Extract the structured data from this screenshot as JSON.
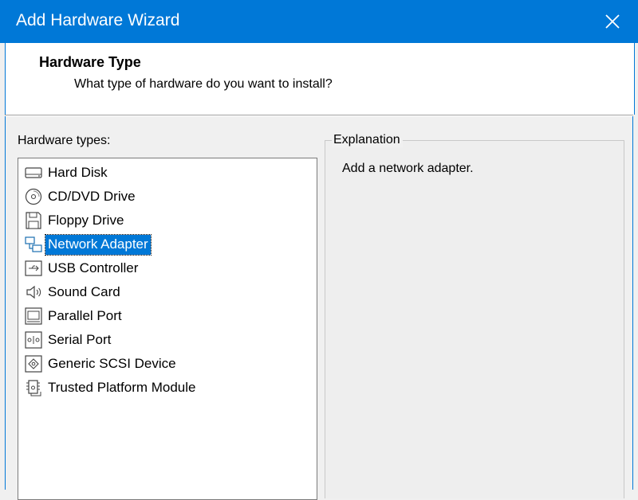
{
  "window": {
    "title": "Add Hardware Wizard"
  },
  "header": {
    "title": "Hardware Type",
    "subtitle": "What type of hardware do you want to install?"
  },
  "list": {
    "label": "Hardware types:",
    "items": [
      {
        "label": "Hard Disk",
        "icon": "hard-disk-icon"
      },
      {
        "label": "CD/DVD Drive",
        "icon": "cd-dvd-icon"
      },
      {
        "label": "Floppy Drive",
        "icon": "floppy-icon"
      },
      {
        "label": "Network Adapter",
        "icon": "network-adapter-icon",
        "selected": true
      },
      {
        "label": "USB Controller",
        "icon": "usb-icon"
      },
      {
        "label": "Sound Card",
        "icon": "speaker-icon"
      },
      {
        "label": "Parallel Port",
        "icon": "parallel-port-icon"
      },
      {
        "label": "Serial Port",
        "icon": "serial-port-icon"
      },
      {
        "label": "Generic SCSI Device",
        "icon": "scsi-icon"
      },
      {
        "label": "Trusted Platform Module",
        "icon": "tpm-chip-icon"
      }
    ]
  },
  "explanation": {
    "title": "Explanation",
    "text": "Add a network adapter."
  },
  "colors": {
    "accent": "#0078d7",
    "selection": "#0078d7"
  }
}
